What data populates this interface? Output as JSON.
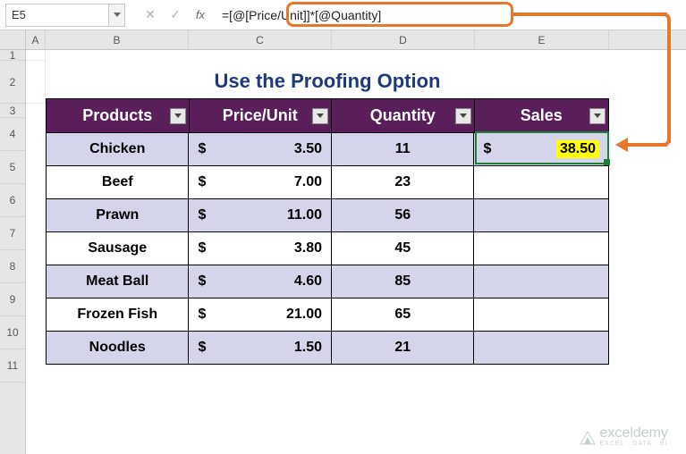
{
  "formulaBar": {
    "nameBox": "E5",
    "formula": "=[@[Price/Unit]]*[@Quantity]"
  },
  "columns": {
    "A": "A",
    "B": "B",
    "C": "C",
    "D": "D",
    "E": "E"
  },
  "rows": [
    "1",
    "2",
    "3",
    "4",
    "5",
    "6",
    "7",
    "8",
    "9",
    "10",
    "11"
  ],
  "title": "Use the Proofing Option",
  "headers": {
    "products": "Products",
    "price": "Price/Unit",
    "quantity": "Quantity",
    "sales": "Sales"
  },
  "data": [
    {
      "product": "Chicken",
      "currency": "$",
      "price": "3.50",
      "qty": "11",
      "sales_cur": "$",
      "sales": "38.50"
    },
    {
      "product": "Beef",
      "currency": "$",
      "price": "7.00",
      "qty": "23",
      "sales_cur": "",
      "sales": ""
    },
    {
      "product": "Prawn",
      "currency": "$",
      "price": "11.00",
      "qty": "56",
      "sales_cur": "",
      "sales": ""
    },
    {
      "product": "Sausage",
      "currency": "$",
      "price": "3.80",
      "qty": "45",
      "sales_cur": "",
      "sales": ""
    },
    {
      "product": "Meat Ball",
      "currency": "$",
      "price": "4.60",
      "qty": "85",
      "sales_cur": "",
      "sales": ""
    },
    {
      "product": "Frozen Fish",
      "currency": "$",
      "price": "21.00",
      "qty": "65",
      "sales_cur": "",
      "sales": ""
    },
    {
      "product": "Noodles",
      "currency": "$",
      "price": "1.50",
      "qty": "21",
      "sales_cur": "",
      "sales": ""
    }
  ],
  "watermark": {
    "brand": "exceldemy",
    "tag": "EXCEL · DATA · BI"
  },
  "chart_data": {
    "type": "table",
    "title": "Use the Proofing Option",
    "columns": [
      "Products",
      "Price/Unit",
      "Quantity",
      "Sales"
    ],
    "rows": [
      [
        "Chicken",
        3.5,
        11,
        38.5
      ],
      [
        "Beef",
        7.0,
        23,
        null
      ],
      [
        "Prawn",
        11.0,
        56,
        null
      ],
      [
        "Sausage",
        3.8,
        45,
        null
      ],
      [
        "Meat Ball",
        4.6,
        85,
        null
      ],
      [
        "Frozen Fish",
        21.0,
        65,
        null
      ],
      [
        "Noodles",
        1.5,
        21,
        null
      ]
    ]
  }
}
